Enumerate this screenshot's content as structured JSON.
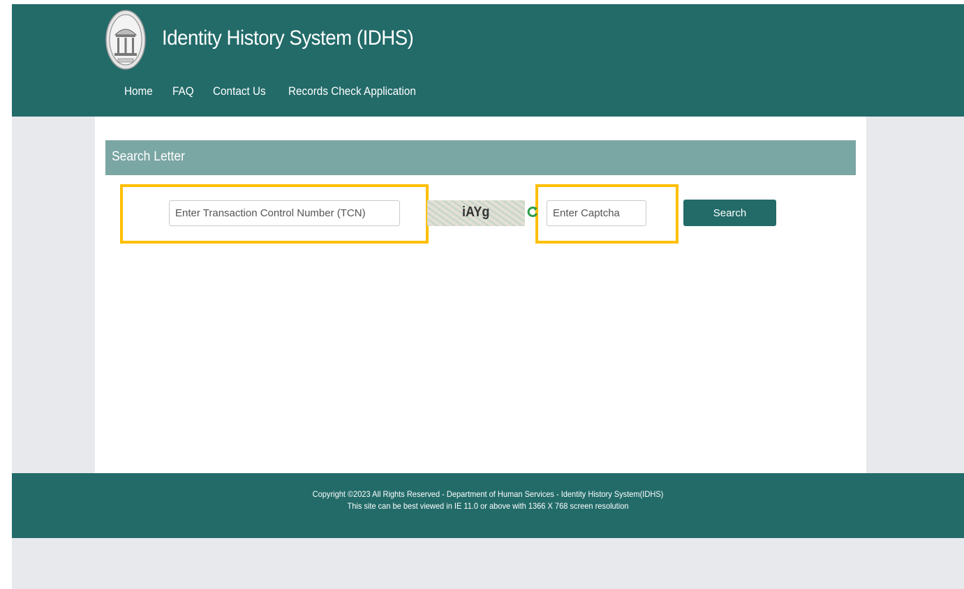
{
  "header": {
    "title": "Identity History System (IDHS)",
    "seal_icon": "state-of-georgia-seal",
    "nav": [
      {
        "label": "Home"
      },
      {
        "label": "FAQ"
      },
      {
        "label": "Contact Us"
      },
      {
        "label": "Records Check Application"
      }
    ]
  },
  "panel": {
    "heading": "Search Letter",
    "tcn_placeholder": "Enter Transaction Control Number (TCN)",
    "captcha_text": "iAYg",
    "captcha_placeholder": "Enter Captcha",
    "search_label": "Search"
  },
  "footer": {
    "line1": "Copyright ©2023 All Rights Reserved - Department of Human Services - Identity History System(IDHS)",
    "line2": "This site can be best viewed in IE 11.0 or above with 1366 X 768 screen resolution"
  },
  "colors": {
    "header_bg": "#226b69",
    "panel_heading_bg": "#7aa6a3",
    "highlight": "#ffbf00",
    "page_bg": "#e8e9ec"
  }
}
